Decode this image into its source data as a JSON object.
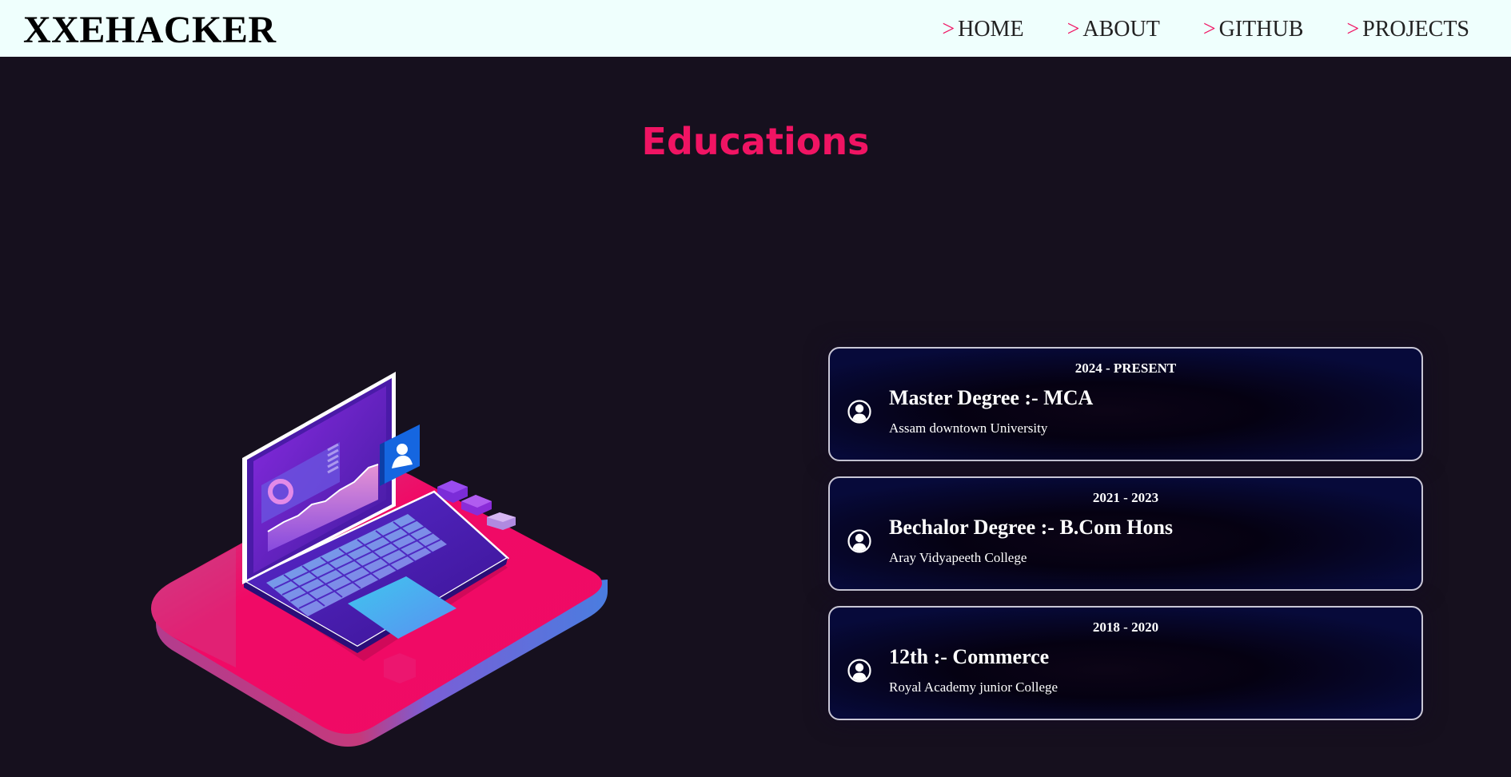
{
  "header": {
    "brand": "XXEHACKER",
    "nav": [
      {
        "prefix": ">",
        "label": "HOME"
      },
      {
        "prefix": ">",
        "label": "ABOUT"
      },
      {
        "prefix": ">",
        "label": "GITHUB"
      },
      {
        "prefix": ">",
        "label": "PROJECTS"
      }
    ]
  },
  "section": {
    "title": "Educations"
  },
  "education": [
    {
      "date": "2024 - PRESENT",
      "title": "Master Degree :- MCA",
      "institution": "Assam downtown University",
      "icon": "user-circle-icon"
    },
    {
      "date": "2021 - 2023",
      "title": "Bechalor Degree :- B.Com Hons",
      "institution": "Aray Vidyapeeth College",
      "icon": "user-circle-icon"
    },
    {
      "date": "2018 - 2020",
      "title": "12th :- Commerce",
      "institution": "Royal Academy junior College",
      "icon": "user-circle-icon"
    }
  ],
  "colors": {
    "accent": "#f01463",
    "background": "#16101e",
    "navbar": "#effffd"
  }
}
